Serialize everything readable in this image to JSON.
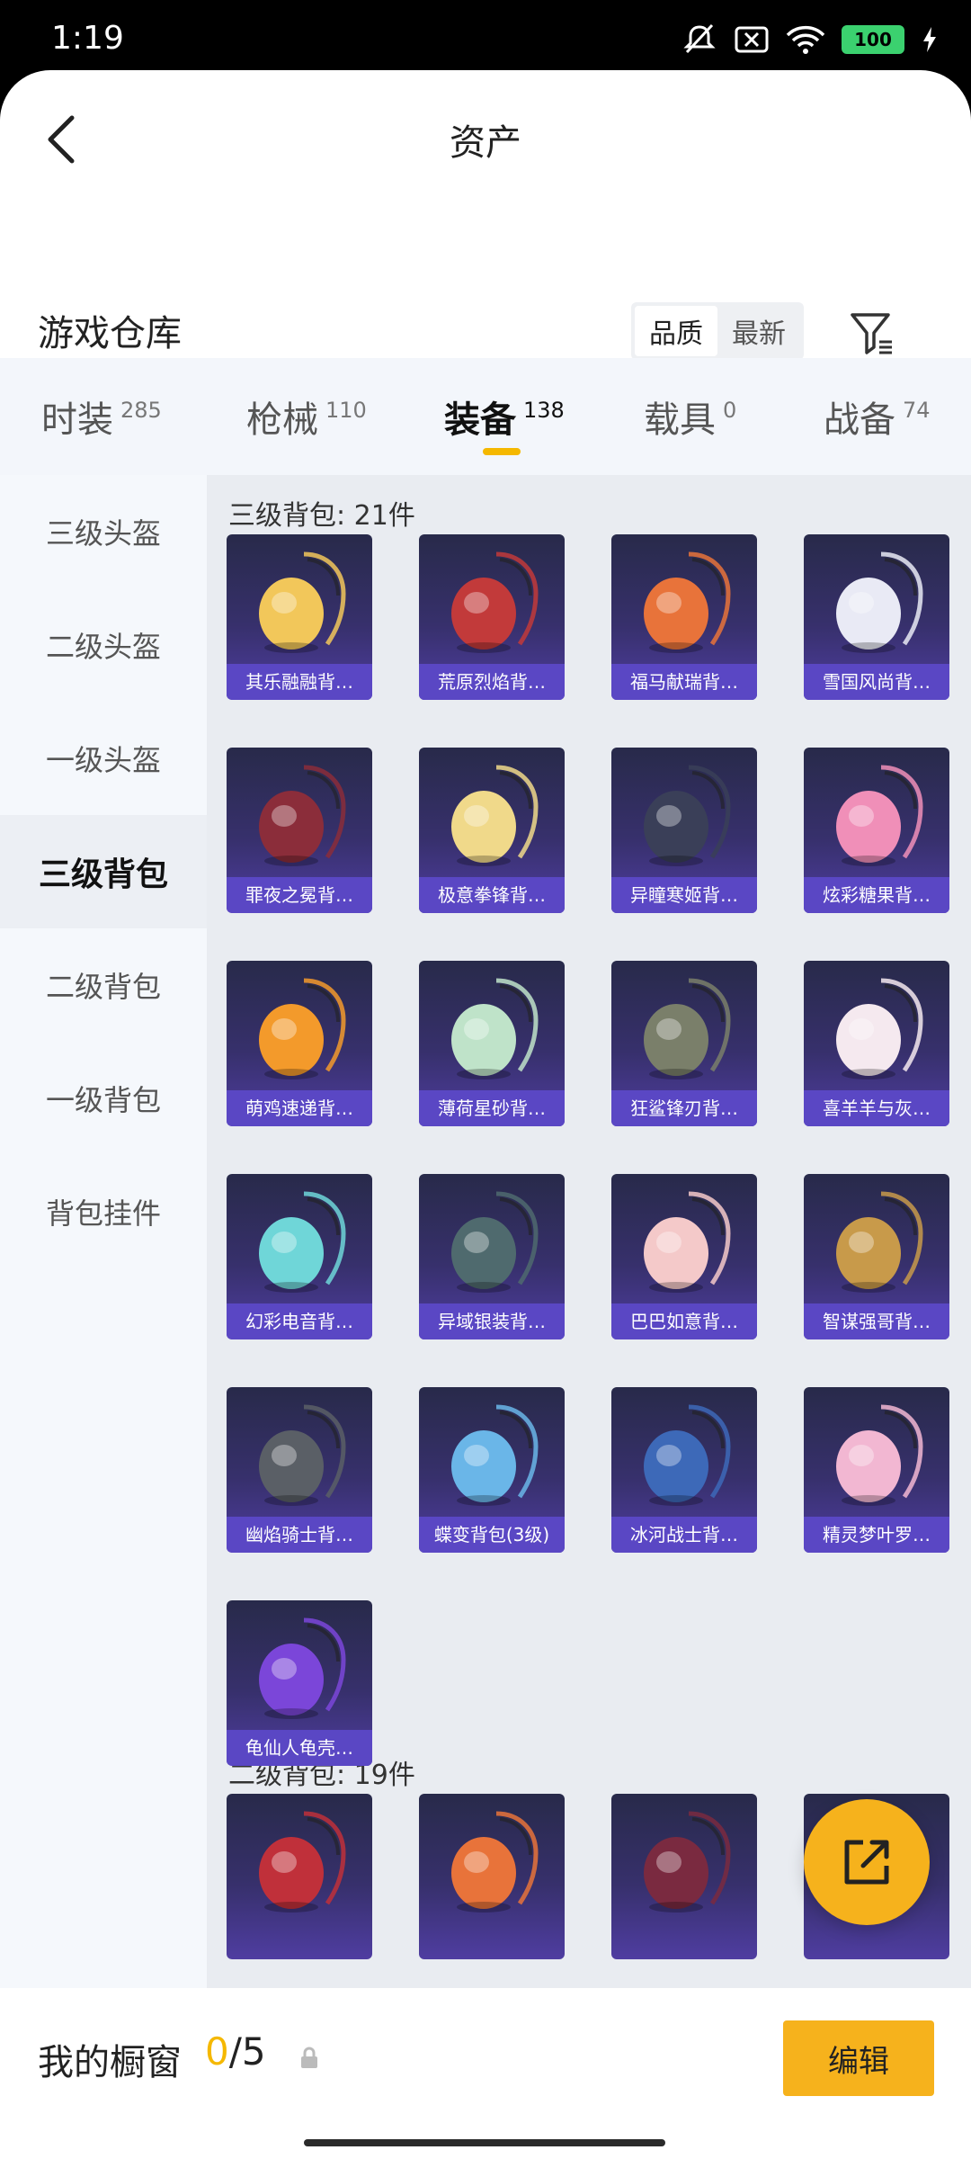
{
  "status_bar": {
    "time": "1:19",
    "battery": "100"
  },
  "nav": {
    "title": "资产"
  },
  "section": {
    "title": "游戏仓库"
  },
  "sort": {
    "options": [
      "品质",
      "最新"
    ],
    "active": "品质"
  },
  "tabs": [
    {
      "label": "时装",
      "count": "285"
    },
    {
      "label": "枪械",
      "count": "110"
    },
    {
      "label": "装备",
      "count": "138"
    },
    {
      "label": "载具",
      "count": "0"
    },
    {
      "label": "战备",
      "count": "74"
    }
  ],
  "sidenav": [
    {
      "label": "三级头盔"
    },
    {
      "label": "二级头盔"
    },
    {
      "label": "一级头盔"
    },
    {
      "label": "三级背包"
    },
    {
      "label": "二级背包"
    },
    {
      "label": "一级背包"
    },
    {
      "label": "背包挂件"
    }
  ],
  "groups": [
    {
      "title": "三级背包: 21件",
      "items": [
        {
          "name": "其乐融融背…",
          "accent": "#f2c75a"
        },
        {
          "name": "荒原烈焰背…",
          "accent": "#c23a3a"
        },
        {
          "name": "福马献瑞背…",
          "accent": "#e8733a"
        },
        {
          "name": "雪国风尚背…",
          "accent": "#e9eaf5"
        },
        {
          "name": "罪夜之冕背…",
          "accent": "#8b2d3a"
        },
        {
          "name": "极意拳锋背…",
          "accent": "#f0d98a"
        },
        {
          "name": "异瞳寒姬背…",
          "accent": "#3a3f58"
        },
        {
          "name": "炫彩糖果背…",
          "accent": "#f08fb8"
        },
        {
          "name": "萌鸡速递背…",
          "accent": "#f39a2b"
        },
        {
          "name": "薄荷星砂背…",
          "accent": "#bfe3c9"
        },
        {
          "name": "狂鲨锋刃背…",
          "accent": "#7a7f6a"
        },
        {
          "name": "喜羊羊与灰…",
          "accent": "#f5e9ef"
        },
        {
          "name": "幻彩电音背…",
          "accent": "#6fd6d8"
        },
        {
          "name": "异域银装背…",
          "accent": "#4f6a6e"
        },
        {
          "name": "巴巴如意背…",
          "accent": "#f4c9c9"
        },
        {
          "name": "智谋强哥背…",
          "accent": "#c89a4a"
        },
        {
          "name": "幽焰骑士背…",
          "accent": "#5a5f66"
        },
        {
          "name": "蝶变背包(3级)",
          "accent": "#6ab6e8"
        },
        {
          "name": "冰河战士背…",
          "accent": "#3d69b8"
        },
        {
          "name": "精灵梦叶罗…",
          "accent": "#f2b7d2"
        },
        {
          "name": "龟仙人龟壳…",
          "accent": "#7b46d9"
        }
      ]
    },
    {
      "title": "二级背包: 19件",
      "items": [
        {
          "name": "",
          "accent": "#c0303a"
        },
        {
          "name": "",
          "accent": "#e8733a"
        },
        {
          "name": "",
          "accent": "#7a2a40"
        },
        {
          "name": "",
          "accent": "#e9eaf5"
        }
      ]
    }
  ],
  "bottom": {
    "label": "我的橱窗",
    "current": "0",
    "total": "/5",
    "edit_label": "编辑"
  }
}
